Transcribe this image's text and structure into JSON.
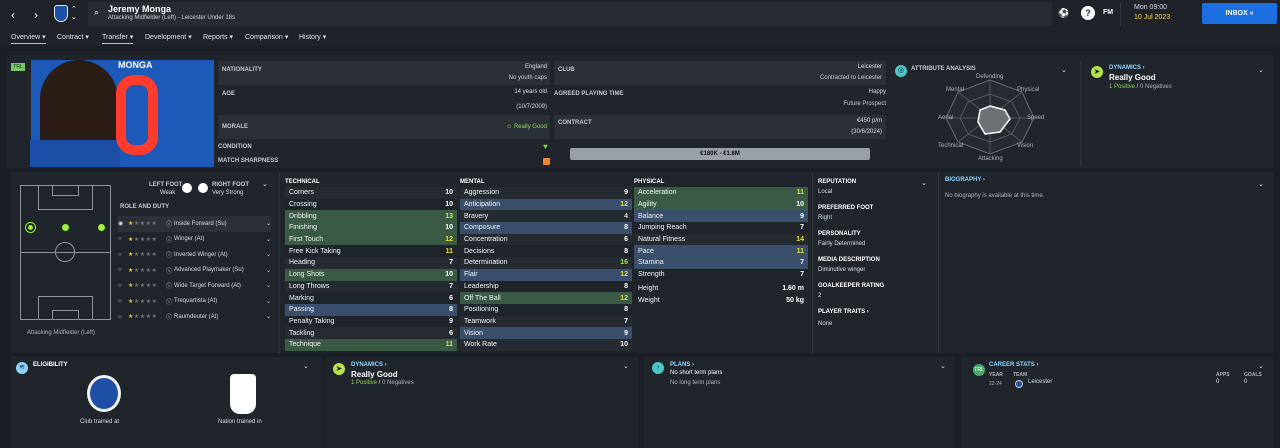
{
  "header": {
    "player_name": "Jeremy Monga",
    "subtitle": "Attacking Midfielder (Left) - Leicester Under 18s",
    "fm_label": "FM",
    "day": "Mon 09:00",
    "date": "10 Jul 2023",
    "inbox_label": "INBOX"
  },
  "nav": [
    "Overview",
    "Contract",
    "Transfer",
    "Development",
    "Reports",
    "Comparison",
    "History"
  ],
  "profile": {
    "badge": "TRL",
    "shirt_name": "MONGA",
    "nationality_label": "NATIONALITY",
    "nationality": "England",
    "youth_caps": "No youth caps",
    "age_label": "AGE",
    "age": "14 years old",
    "dob": "(10/7/2009)",
    "morale_label": "MORALE",
    "morale": "Really Good",
    "condition_label": "CONDITION",
    "sharpness_label": "MATCH SHARPNESS",
    "club_label": "CLUB",
    "club": "Leicester",
    "contract_type": "Contracted to Leicester",
    "playing_time_label": "AGREED PLAYING TIME",
    "playing_time": "Happy",
    "future_prospect": "Future Prospect",
    "contract_label": "CONTRACT",
    "wage": "€450 p/m",
    "contract_end": "(30/6/2024)",
    "value_range": "€180K - €1.8M"
  },
  "attribute_analysis": {
    "title": "ATTRIBUTE ANALYSIS",
    "labels": [
      "Defending",
      "Physical",
      "Speed",
      "Vision",
      "Attacking",
      "Technical",
      "Aerial",
      "Mental"
    ]
  },
  "dynamics": {
    "title": "DYNAMICS",
    "value": "Really Good",
    "positives": "1 Positive",
    "negatives": "0 Negatives"
  },
  "position": {
    "left_foot_label": "LEFT FOOT",
    "left_foot": "Weak",
    "right_foot_label": "RIGHT FOOT",
    "right_foot": "Very Strong",
    "role_duty_label": "ROLE AND DUTY",
    "position_label": "Attacking Midfielder (Left)",
    "roles": [
      {
        "name": "Inside Forward (Su)",
        "stars": 1,
        "selected": true
      },
      {
        "name": "Winger (At)",
        "stars": 1,
        "selected": false
      },
      {
        "name": "Inverted Winger (At)",
        "stars": 1,
        "selected": false
      },
      {
        "name": "Advanced Playmaker (Su)",
        "stars": 1,
        "selected": false
      },
      {
        "name": "Wide Target Forward (At)",
        "stars": 1,
        "selected": false
      },
      {
        "name": "Trequartista (At)",
        "stars": 1,
        "selected": false
      },
      {
        "name": "Raumdeuter (At)",
        "stars": 1,
        "selected": false
      }
    ]
  },
  "technical": {
    "title": "TECHNICAL",
    "attrs": [
      {
        "name": "Corners",
        "value": "10"
      },
      {
        "name": "Crossing",
        "value": "10"
      },
      {
        "name": "Dribbling",
        "value": "13"
      },
      {
        "name": "Finishing",
        "value": "10"
      },
      {
        "name": "First Touch",
        "value": "12"
      },
      {
        "name": "Free Kick Taking",
        "value": "11"
      },
      {
        "name": "Heading",
        "value": "7"
      },
      {
        "name": "Long Shots",
        "value": "10"
      },
      {
        "name": "Long Throws",
        "value": "7"
      },
      {
        "name": "Marking",
        "value": "6"
      },
      {
        "name": "Passing",
        "value": "8"
      },
      {
        "name": "Penalty Taking",
        "value": "9"
      },
      {
        "name": "Tackling",
        "value": "6"
      },
      {
        "name": "Technique",
        "value": "11"
      }
    ]
  },
  "mental": {
    "title": "MENTAL",
    "attrs": [
      {
        "name": "Aggression",
        "value": "9"
      },
      {
        "name": "Anticipation",
        "value": "12"
      },
      {
        "name": "Bravery",
        "value": "4"
      },
      {
        "name": "Composure",
        "value": "8"
      },
      {
        "name": "Concentration",
        "value": "6"
      },
      {
        "name": "Decisions",
        "value": "8"
      },
      {
        "name": "Determination",
        "value": "16"
      },
      {
        "name": "Flair",
        "value": "12"
      },
      {
        "name": "Leadership",
        "value": "8"
      },
      {
        "name": "Off The Ball",
        "value": "12"
      },
      {
        "name": "Positioning",
        "value": "8"
      },
      {
        "name": "Teamwork",
        "value": "7"
      },
      {
        "name": "Vision",
        "value": "9"
      },
      {
        "name": "Work Rate",
        "value": "10"
      }
    ]
  },
  "physical": {
    "title": "PHYSICAL",
    "attrs": [
      {
        "name": "Acceleration",
        "value": "11"
      },
      {
        "name": "Agility",
        "value": "10"
      },
      {
        "name": "Balance",
        "value": "9"
      },
      {
        "name": "Jumping Reach",
        "value": "7"
      },
      {
        "name": "Natural Fitness",
        "value": "14"
      },
      {
        "name": "Pace",
        "value": "11"
      },
      {
        "name": "Stamina",
        "value": "7"
      },
      {
        "name": "Strength",
        "value": "7"
      }
    ],
    "height_label": "Height",
    "height": "1.60 m",
    "weight_label": "Weight",
    "weight": "50 kg"
  },
  "info": {
    "reputation_label": "REPUTATION",
    "reputation": "Local",
    "foot_label": "PREFERRED FOOT",
    "foot": "Right",
    "personality_label": "PERSONALITY",
    "personality": "Fairly Determined",
    "media_label": "MEDIA DESCRIPTION",
    "media": "Diminutive winger",
    "gk_label": "GOALKEEPER RATING",
    "gk": "2",
    "traits_label": "PLAYER TRAITS",
    "traits": "None"
  },
  "biography": {
    "title": "BIOGRAPHY",
    "text": "No biography is available at this time."
  },
  "eligibility": {
    "title": "ELIGIBILITY",
    "club": "Club trained at",
    "nation": "Nation trained in"
  },
  "plans": {
    "title": "PLANS",
    "short": "No short term plans",
    "long": "No long term plans"
  },
  "career": {
    "title": "CAREER STATS",
    "year_label": "YEAR",
    "team_label": "TEAM",
    "apps_label": "APPS",
    "goals_label": "GOALS",
    "year": "22-24",
    "team": "Leicester",
    "apps": "0",
    "goals": "0"
  },
  "colors": {
    "accent": "#1c6fe0",
    "highlight_green": "#3a5a45",
    "highlight_blue": "#3a4f6b",
    "good": "#e8e534"
  }
}
